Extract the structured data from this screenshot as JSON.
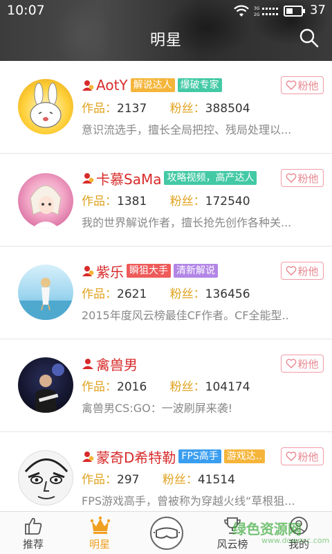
{
  "status_bar": {
    "time": "10:07",
    "battery": "37"
  },
  "header": {
    "title": "明星"
  },
  "labels": {
    "works": "作品：",
    "fans": "粉丝：",
    "fan_button": "粉他"
  },
  "stars": [
    {
      "name": "AotY",
      "tags": [
        {
          "text": "解说达人",
          "color": "orange"
        },
        {
          "text": "爆破专家",
          "color": "teal"
        }
      ],
      "works": "2137",
      "fans": "388504",
      "desc": "意识流选手，擅长全局把控、残局处理以..."
    },
    {
      "name": "卡慕SaMa",
      "tags": [
        {
          "text": "攻略视频，高产达人",
          "color": "teal"
        }
      ],
      "works": "1381",
      "fans": "172540",
      "desc": "我的世界解说作者，擅长抢先创作各种关..."
    },
    {
      "name": "紫乐",
      "tags": [
        {
          "text": "瞬狙大手",
          "color": "red"
        },
        {
          "text": "清新解说",
          "color": "purple"
        }
      ],
      "works": "2621",
      "fans": "136456",
      "desc": "2015年度风云榜最佳CF作者。CF全能型.."
    },
    {
      "name": "禽兽男",
      "tags": [],
      "works": "2016",
      "fans": "104174",
      "desc": "禽兽男CS:GO：一波刷屏来袭!"
    },
    {
      "name": "蒙奇D希特勒",
      "tags": [
        {
          "text": "FPS高手",
          "color": "blue"
        },
        {
          "text": "游戏达..",
          "color": "orange"
        }
      ],
      "works": "297",
      "fans": "41514",
      "desc": "FPS游戏高手，曾被称为穿越火线“草根狙..."
    }
  ],
  "tabbar": {
    "tabs": [
      {
        "label": "推荐",
        "icon": "thumbs-up-icon"
      },
      {
        "label": "明星",
        "icon": "crown-icon"
      },
      {
        "label": "",
        "icon": "goggles-icon"
      },
      {
        "label": "风云榜",
        "icon": "trophy-icon"
      },
      {
        "label": "我的",
        "icon": "profile-icon"
      }
    ],
    "active": "明星"
  },
  "watermark": {
    "text": "绿色资源网",
    "url": "www.downcc.com"
  },
  "colors": {
    "accent": "#f0a020",
    "name_red": "#d82a2a",
    "fan_pink": "#e7868f"
  }
}
